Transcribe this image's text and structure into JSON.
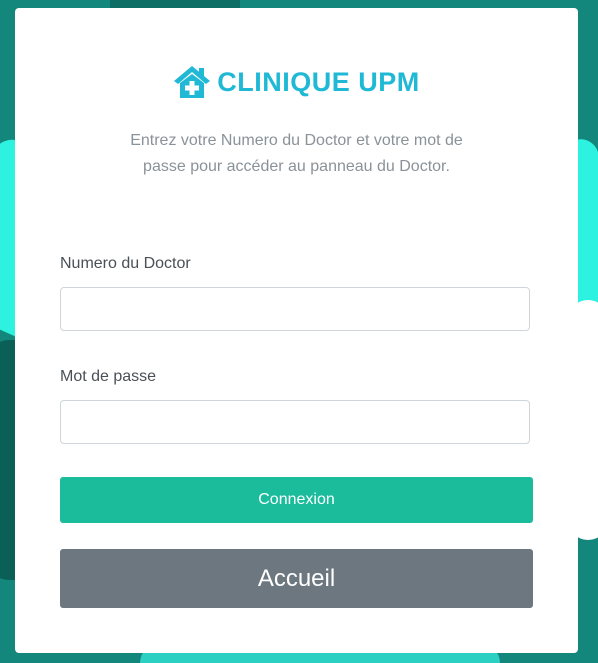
{
  "brand": {
    "name": "CLINIQUE UPM",
    "color": "#1fb9d6",
    "icon": "clinic-house-plus-icon"
  },
  "subtitle": "Entrez votre Numero du Doctor et votre mot de passe pour accéder au panneau du Doctor.",
  "form": {
    "doctor_number": {
      "label": "Numero du Doctor",
      "value": "",
      "placeholder": ""
    },
    "password": {
      "label": "Mot de passe",
      "value": "",
      "placeholder": ""
    }
  },
  "buttons": {
    "login": {
      "label": "Connexion",
      "color": "#1abc9c"
    },
    "home": {
      "label": "Accueil",
      "color": "#6d7780"
    }
  }
}
